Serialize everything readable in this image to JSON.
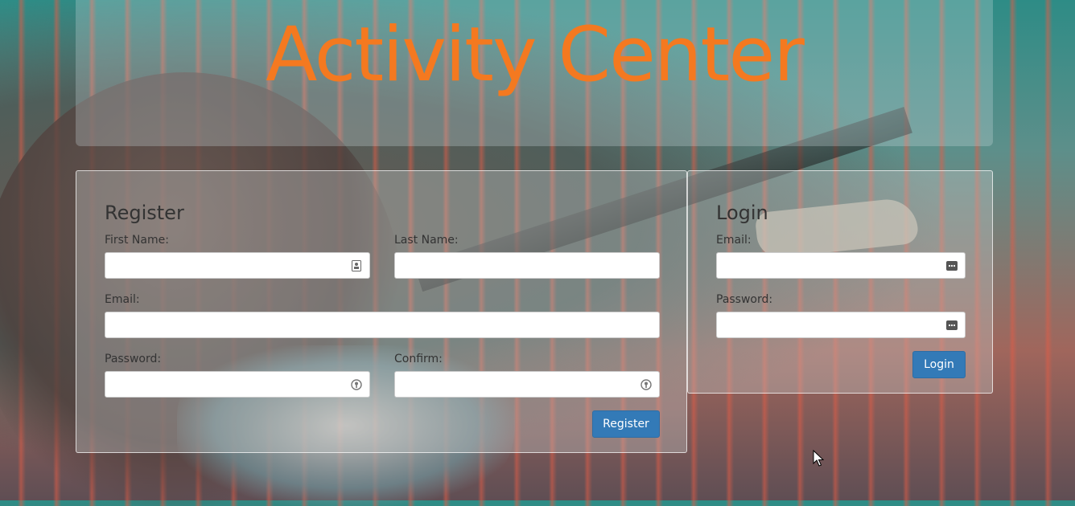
{
  "header": {
    "title": "Activity Center"
  },
  "register": {
    "title": "Register",
    "first_name_label": "First Name:",
    "last_name_label": "Last Name:",
    "email_label": "Email:",
    "password_label": "Password:",
    "confirm_label": "Confirm:",
    "first_name_value": "",
    "last_name_value": "",
    "email_value": "",
    "password_value": "",
    "confirm_value": "",
    "submit_label": "Register"
  },
  "login": {
    "title": "Login",
    "email_label": "Email:",
    "password_label": "Password:",
    "email_value": "",
    "password_value": "",
    "submit_label": "Login"
  },
  "icons": {
    "contact_card": "contact-card-icon",
    "password_manager": "password-manager-icon",
    "key": "key-icon",
    "cursor": "mouse-cursor-icon"
  },
  "colors": {
    "title": "#f47920",
    "button": "#337ab7"
  }
}
